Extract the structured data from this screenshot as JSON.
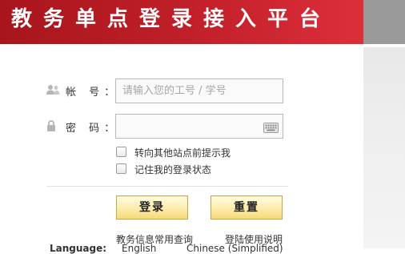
{
  "header": {
    "title": "教务单点登录接入平台"
  },
  "form": {
    "account_label": "帐 号：",
    "account_placeholder": "请输入您的工号 / 学号",
    "password_label": "密 码：",
    "password_value": "",
    "options": [
      {
        "label": "转向其他站点前提示我",
        "checked": false
      },
      {
        "label": "记住我的登录状态",
        "checked": false
      }
    ],
    "login_button": "登录",
    "reset_button": "重置"
  },
  "links": {
    "query": "教务信息常用查询",
    "help": "登陆使用说明"
  },
  "language": {
    "label": "Language:",
    "english": "English",
    "chinese": "Chinese (Simplified)"
  },
  "colors": {
    "header": "#c2202a",
    "button_fill": "#fdeeb0",
    "side_panel": "#9a9a9a"
  }
}
